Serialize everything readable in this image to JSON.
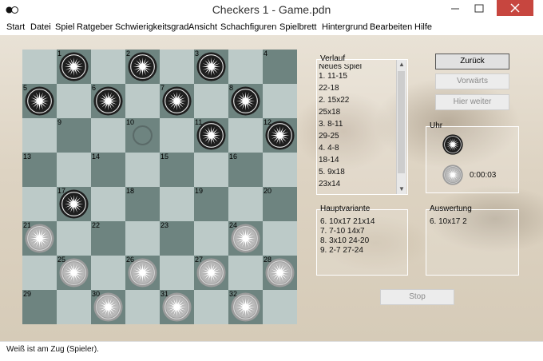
{
  "window": {
    "title": "Checkers 1 - Game.pdn"
  },
  "menu": [
    "Start",
    "Datei",
    "Spiel",
    "Ratgeber",
    "Schwierigkeitsgrad",
    "Ansicht",
    "Schachfiguren",
    "Spielbrett",
    "Hintergrund",
    "Bearbeiten",
    "Hilfe"
  ],
  "board": {
    "colors": {
      "light": "#bccac8",
      "dark": "#6e8480"
    },
    "squares": [
      {
        "n": "1",
        "piece": "black"
      },
      {
        "n": "2",
        "piece": "black"
      },
      {
        "n": "3",
        "piece": "black"
      },
      {
        "n": "4",
        "piece": ""
      },
      {
        "n": "5",
        "piece": "black"
      },
      {
        "n": "6",
        "piece": "black"
      },
      {
        "n": "7",
        "piece": "black"
      },
      {
        "n": "8",
        "piece": "black"
      },
      {
        "n": "9",
        "piece": ""
      },
      {
        "n": "10",
        "piece": "empty"
      },
      {
        "n": "11",
        "piece": "black"
      },
      {
        "n": "12",
        "piece": "black"
      },
      {
        "n": "13",
        "piece": ""
      },
      {
        "n": "14",
        "piece": ""
      },
      {
        "n": "15",
        "piece": ""
      },
      {
        "n": "16",
        "piece": ""
      },
      {
        "n": "17",
        "piece": "black"
      },
      {
        "n": "18",
        "piece": ""
      },
      {
        "n": "19",
        "piece": ""
      },
      {
        "n": "20",
        "piece": ""
      },
      {
        "n": "21",
        "piece": "white"
      },
      {
        "n": "22",
        "piece": ""
      },
      {
        "n": "23",
        "piece": ""
      },
      {
        "n": "24",
        "piece": "white"
      },
      {
        "n": "25",
        "piece": "white"
      },
      {
        "n": "26",
        "piece": "white"
      },
      {
        "n": "27",
        "piece": "white"
      },
      {
        "n": "28",
        "piece": "white"
      },
      {
        "n": "29",
        "piece": ""
      },
      {
        "n": "30",
        "piece": "white"
      },
      {
        "n": "31",
        "piece": "white"
      },
      {
        "n": "32",
        "piece": "white"
      }
    ]
  },
  "verlauf": {
    "label": "Verlauf",
    "header": "Neues Spiel",
    "moves": [
      "1. 11-15",
      "22-18",
      "2. 15x22",
      "25x18",
      "3. 8-11",
      "29-25",
      "4. 4-8",
      "18-14",
      "5. 9x18",
      "23x14",
      "6. 10x17"
    ],
    "selected_index": 10
  },
  "buttons": {
    "back": "Zurück",
    "forward": "Vorwärts",
    "continue": "Hier weiter",
    "stop": "Stop"
  },
  "uhr": {
    "label": "Uhr",
    "time": "0:00:03"
  },
  "hauptvariante": {
    "label": "Hauptvariante",
    "lines": [
      "6. 10x17 21x14",
      "7. 7-10 14x7",
      "8. 3x10 24-20",
      "9. 2-7 27-24"
    ]
  },
  "auswertung": {
    "label": "Auswertung",
    "lines": [
      "6. 10x17 2"
    ]
  },
  "status": "Weiß ist am Zug (Spieler)."
}
